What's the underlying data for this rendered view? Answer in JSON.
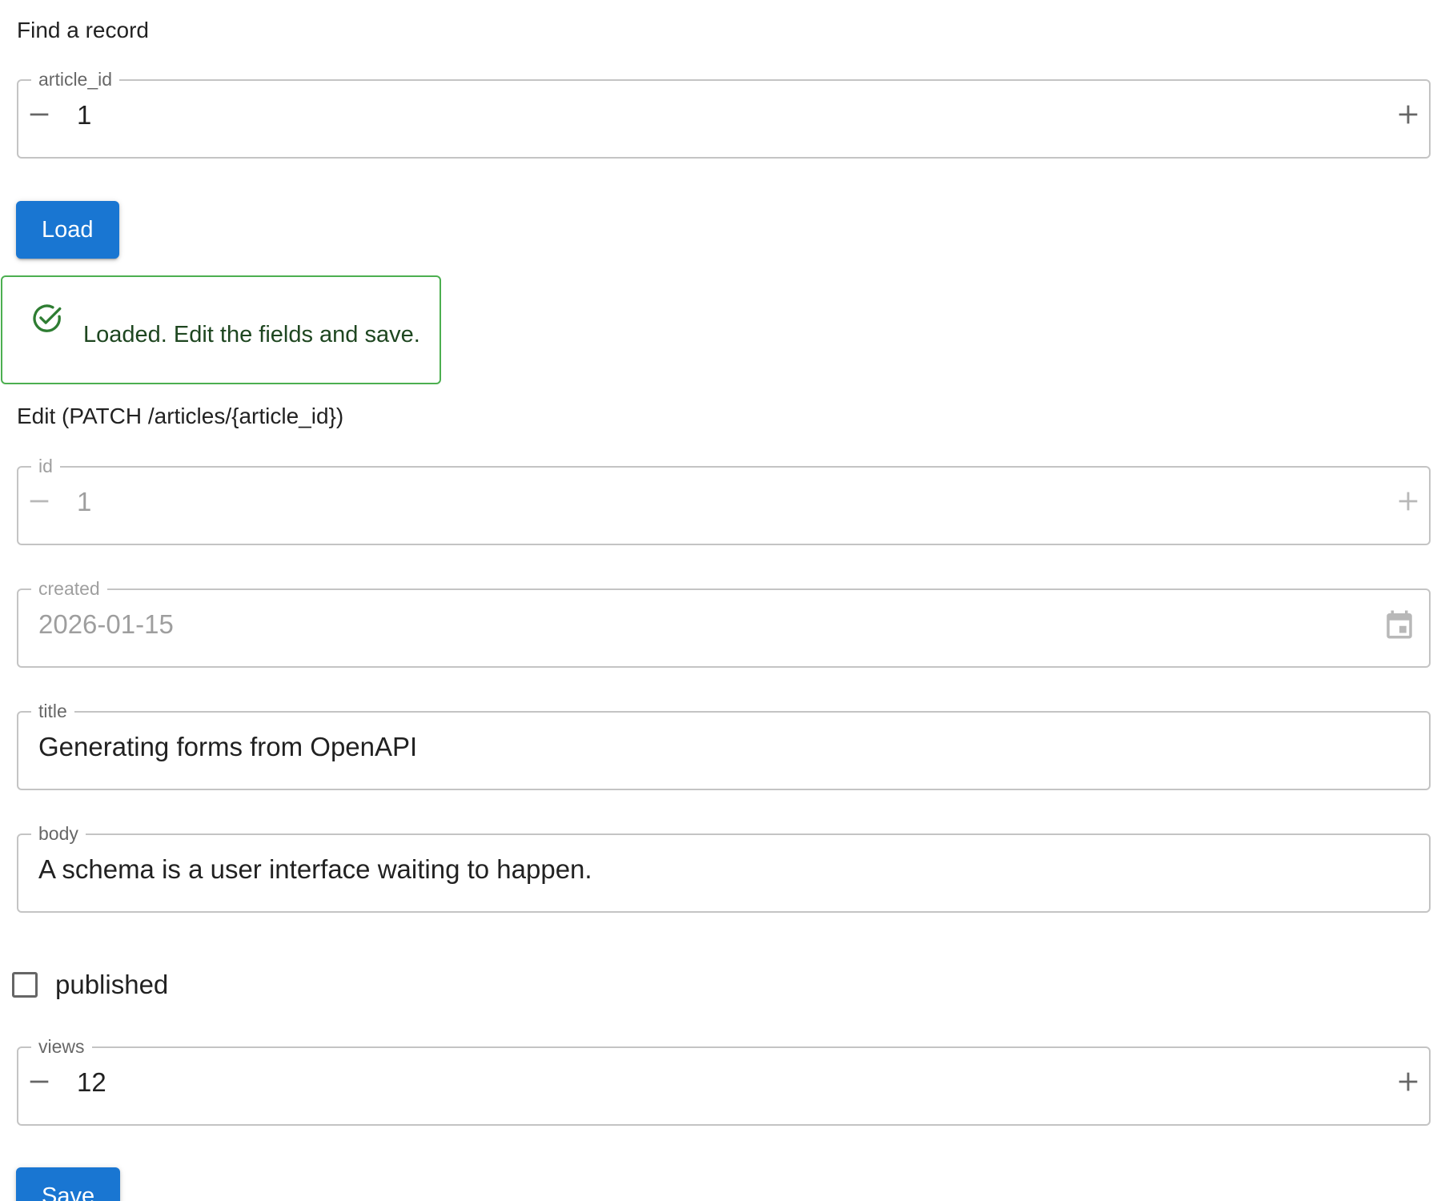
{
  "find_section": {
    "title": "Find a record",
    "article_id": {
      "label": "article_id",
      "value": "1"
    },
    "load_button": "Load"
  },
  "alert": {
    "severity": "success",
    "color": "#4caf50",
    "text_color": "#1e4620",
    "icon": "check-circle-outline-icon",
    "message": "Loaded. Edit the fields and save."
  },
  "edit_section": {
    "title": "Edit (PATCH /articles/{article_id})",
    "id": {
      "label": "id",
      "value": "1",
      "disabled": true
    },
    "created": {
      "label": "created",
      "value": "2026-01-15",
      "disabled": true
    },
    "title_field": {
      "label": "title",
      "value": "Generating forms from OpenAPI"
    },
    "body": {
      "label": "body",
      "value": "A schema is a user interface waiting to happen."
    },
    "published": {
      "label": "published",
      "checked": false
    },
    "views": {
      "label": "views",
      "value": "12"
    },
    "save_button": "Save"
  },
  "colors": {
    "primary": "#1976d2",
    "border": "rgba(0,0,0,0.23)"
  }
}
